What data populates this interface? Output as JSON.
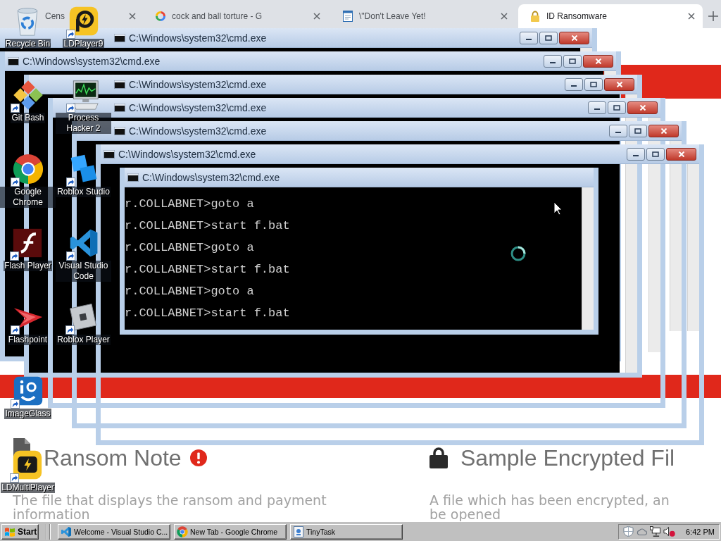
{
  "browser": {
    "tabs": [
      {
        "title": "Cens",
        "selected": false
      },
      {
        "title": "cock and ball torture - G",
        "selected": false
      },
      {
        "title": "\\\"Don't Leave Yet!",
        "selected": false
      },
      {
        "title": "ID Ransomware",
        "selected": true
      }
    ],
    "page": {
      "sections": [
        {
          "heading": "Ransom Note",
          "description": "The file that displays the ransom and payment\ninformation"
        },
        {
          "heading": "Sample Encrypted Fil",
          "description": "A file which has been encrypted, an\nbe opened"
        }
      ]
    }
  },
  "windows": [
    {
      "title": "C:\\Windows\\system32\\cmd.exe",
      "title_buttons": true
    },
    {
      "title": "C:\\Windows\\system32\\cmd.exe",
      "title_buttons": true
    },
    {
      "title": "C:\\Windows\\system32\\cmd.exe",
      "title_buttons": true
    },
    {
      "title": "C:\\Windows\\system32\\cmd.exe",
      "title_buttons": true
    },
    {
      "title": "C:\\Windows\\system32\\cmd.exe",
      "title_buttons": true
    },
    {
      "title": "C:\\Windows\\system32\\cmd.exe",
      "title_buttons": true
    },
    {
      "title": "C:\\Windows\\system32\\cmd.exe",
      "title_buttons": false,
      "lines": [
        "r.COLLABNET>goto a",
        "r.COLLABNET>start f.bat",
        "r.COLLABNET>goto a",
        "r.COLLABNET>start f.bat",
        "r.COLLABNET>goto a",
        "r.COLLABNET>start f.bat"
      ]
    }
  ],
  "desktop_icons": [
    {
      "label": "Recycle Bin",
      "shortcut": false
    },
    {
      "label": "Git Bash",
      "shortcut": true
    },
    {
      "label": "Google Chrome",
      "shortcut": true
    },
    {
      "label": "Flash Player",
      "shortcut": true
    },
    {
      "label": "Flashpoint",
      "shortcut": true
    },
    {
      "label": "ImageGlass",
      "shortcut": true
    },
    {
      "label": "LDMultiPlayer",
      "shortcut": true
    },
    {
      "label": "LDPlayer9",
      "shortcut": true
    },
    {
      "label": "Process Hacker 2",
      "shortcut": true
    },
    {
      "label": "Roblox Studio",
      "shortcut": true
    },
    {
      "label": "Visual Studio Code",
      "shortcut": true
    },
    {
      "label": "Roblox Player",
      "shortcut": true
    }
  ],
  "taskbar": {
    "start": "Start",
    "tasks": [
      {
        "label": "Welcome - Visual Studio C...",
        "selected": false
      },
      {
        "label": "New Tab - Google Chrome",
        "selected": false
      },
      {
        "label": "TinyTask",
        "selected": false
      }
    ],
    "clock": "6:42 PM"
  }
}
